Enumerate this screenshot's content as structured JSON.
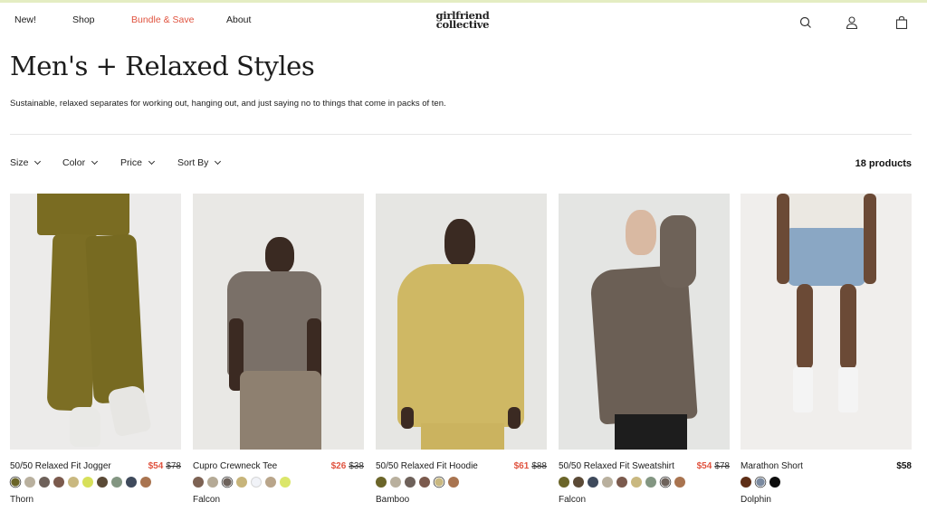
{
  "nav": {
    "links": [
      "New!",
      "Shop",
      "Bundle & Save",
      "About"
    ],
    "logo_line1": "girlfriend",
    "logo_line2": "collective",
    "icons": [
      "search-icon",
      "account-icon",
      "bag-icon"
    ]
  },
  "page": {
    "title": "Men's + Relaxed Styles",
    "subtitle": "Sustainable, relaxed separates for working out, hanging out, and just saying no to things that come in packs of ten."
  },
  "filters": {
    "items": [
      "Size",
      "Color",
      "Price",
      "Sort By"
    ],
    "count": "18 products"
  },
  "colors": {
    "accent_sale": "#e0533f",
    "top_bar": "#e4edc2"
  },
  "products": [
    {
      "name": "50/50 Relaxed Fit Jogger",
      "sale_price": "$54",
      "original_price": "$78",
      "color_name": "Thorn",
      "selected_swatch": 0,
      "swatches": [
        "#6b6529",
        "#b9b09e",
        "#6e615a",
        "#7b5a4d",
        "#c9b880",
        "#d7e05a",
        "#5b4a36",
        "#839682",
        "#3f4a5c",
        "#a97450"
      ]
    },
    {
      "name": "Cupro Crewneck Tee",
      "sale_price": "$26",
      "original_price": "$38",
      "color_name": "Falcon",
      "selected_swatch": 2,
      "swatches": [
        "#7d6253",
        "#b5aa96",
        "#6e635c",
        "#c7b47a",
        "#f1f3f8",
        "#b9a58a",
        "#dbe66a"
      ]
    },
    {
      "name": "50/50 Relaxed Fit Hoodie",
      "sale_price": "$61",
      "original_price": "$88",
      "color_name": "Bamboo",
      "selected_swatch": 4,
      "swatches": [
        "#6b6529",
        "#b9b09e",
        "#6e615a",
        "#7b5a4d",
        "#c9b880",
        "#a97450"
      ]
    },
    {
      "name": "50/50 Relaxed Fit Sweatshirt",
      "sale_price": "$54",
      "original_price": "$78",
      "color_name": "Falcon",
      "selected_swatch": 7,
      "swatches": [
        "#6b6529",
        "#5b4a36",
        "#3f4a5c",
        "#b9b09e",
        "#7b5a4d",
        "#c9b880",
        "#839682",
        "#6e635c",
        "#a97450"
      ]
    },
    {
      "name": "Marathon Short",
      "price": "$58",
      "color_name": "Dolphin",
      "selected_swatch": 1,
      "swatches": [
        "#5e2e16",
        "#7b8aa0",
        "#0d0d0d"
      ]
    }
  ]
}
